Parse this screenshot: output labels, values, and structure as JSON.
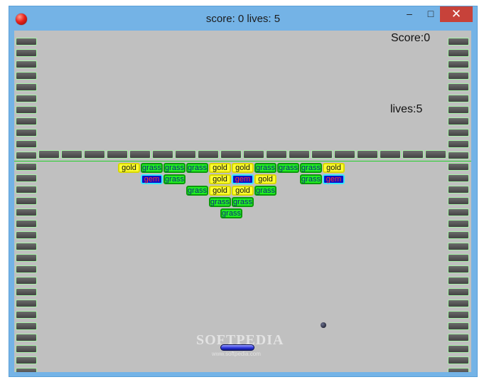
{
  "window": {
    "title": "score: 0 lives: 5",
    "minimize_glyph": "–",
    "maximize_glyph": "□",
    "close_glyph": "✕",
    "app_icon": "red-ball-icon"
  },
  "hud": {
    "score_label": "Score:0",
    "lives_label": "lives:5"
  },
  "watermark": {
    "text": "SOFTPEDIA",
    "url": "www.softpedia.com"
  },
  "blocks": {
    "rows": [
      [
        "gold",
        "grass",
        "grass",
        "grass",
        "gold",
        "gold",
        "grass",
        "grass",
        "grass",
        "gold"
      ],
      [
        "gem",
        "grass",
        "",
        "gold",
        "gem",
        "gold",
        "",
        "grass",
        "gem"
      ],
      [
        "grass",
        "gold",
        "gold",
        "grass"
      ],
      [
        "grass",
        "grass"
      ],
      [
        "grass"
      ]
    ],
    "labels": {
      "gold": "gold",
      "grass": "grass",
      "gem": "gem"
    }
  },
  "colors": {
    "background": "#c0c0c0",
    "frame": "#74b3e6",
    "brick_outline": "#a8f2a8",
    "ball": "#0d0f1c",
    "paddle": "#2730d8"
  }
}
